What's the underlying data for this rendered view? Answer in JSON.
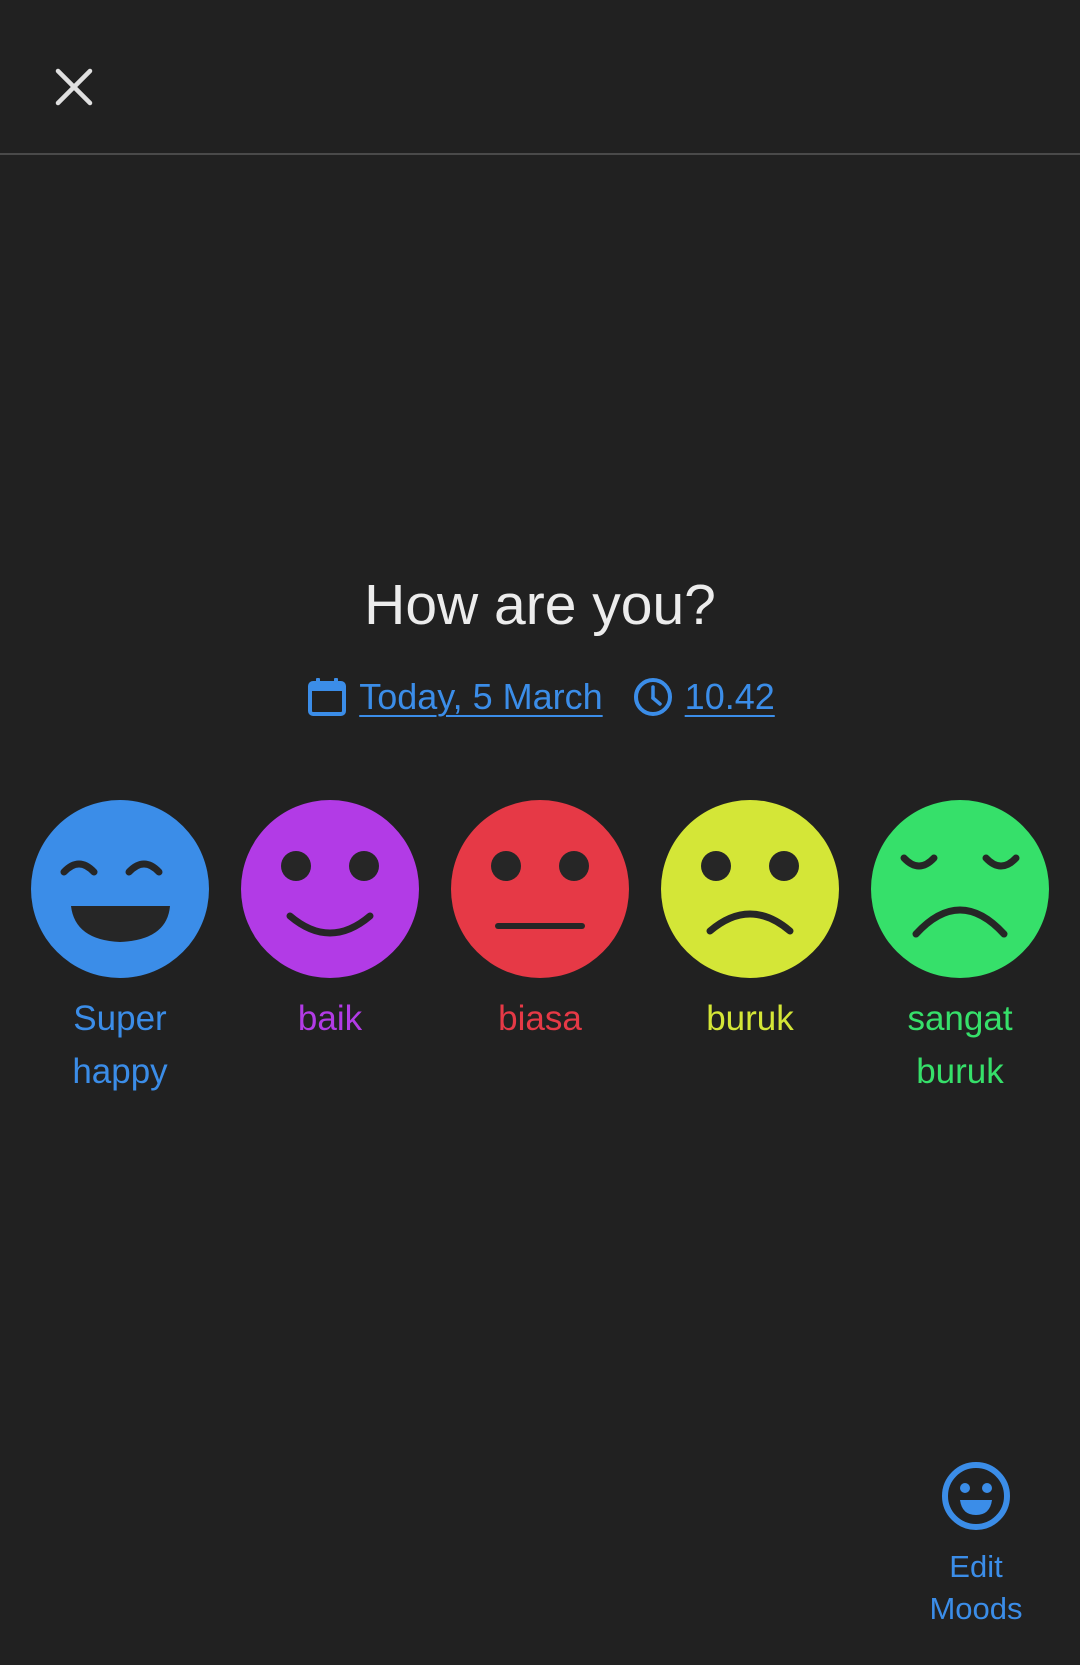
{
  "header": {
    "close_icon": "close-icon"
  },
  "main": {
    "title": "How are you?",
    "date": {
      "icon": "calendar-icon",
      "label": "Today, 5 March"
    },
    "time": {
      "icon": "clock-icon",
      "label": "10.42"
    }
  },
  "moods": [
    {
      "label": "Super happy",
      "color": "#3b8de8",
      "icon": "laughing-face-icon"
    },
    {
      "label": "baik",
      "color": "#b23be6",
      "icon": "smiling-face-icon"
    },
    {
      "label": "biasa",
      "color": "#e63946",
      "icon": "neutral-face-icon"
    },
    {
      "label": "buruk",
      "color": "#d4e637",
      "icon": "sad-face-icon"
    },
    {
      "label": "sangat buruk",
      "color": "#36e06a",
      "icon": "very-sad-face-icon"
    }
  ],
  "edit_moods": {
    "icon": "smiley-outline-icon",
    "label": "Edit Moods"
  }
}
